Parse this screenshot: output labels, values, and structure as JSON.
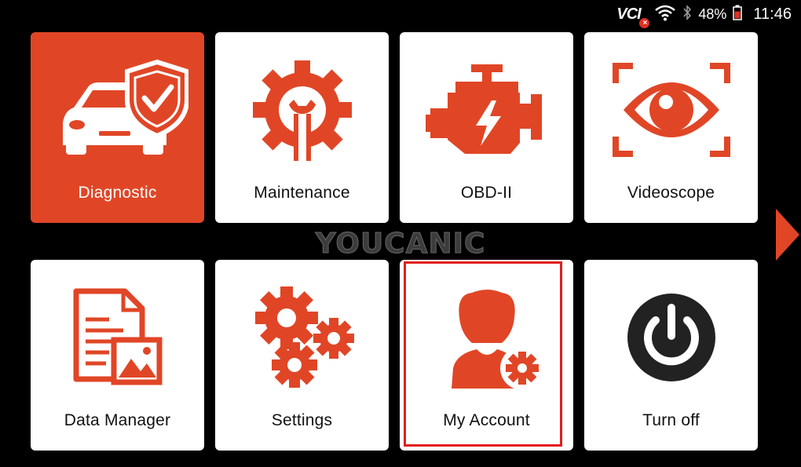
{
  "status_bar": {
    "vci_label": "VCI",
    "vci_status": "×",
    "battery_percent": "48%",
    "time": "11:46"
  },
  "watermark": "YOUCANIC",
  "tiles": [
    {
      "label": "Diagnostic",
      "icon": "car-shield-icon",
      "active": true
    },
    {
      "label": "Maintenance",
      "icon": "gear-wrench-icon"
    },
    {
      "label": "OBD-II",
      "icon": "engine-icon"
    },
    {
      "label": "Videoscope",
      "icon": "eye-scan-icon"
    },
    {
      "label": "Data Manager",
      "icon": "document-image-icon"
    },
    {
      "label": "Settings",
      "icon": "gears-icon"
    },
    {
      "label": "My Account",
      "icon": "user-gear-icon",
      "highlighted": true
    },
    {
      "label": "Turn off",
      "icon": "power-icon"
    }
  ],
  "colors": {
    "accent": "#e04626",
    "background": "#000000",
    "tile": "#ffffff",
    "highlight_border": "#e01d1d",
    "power_dark": "#222222"
  }
}
